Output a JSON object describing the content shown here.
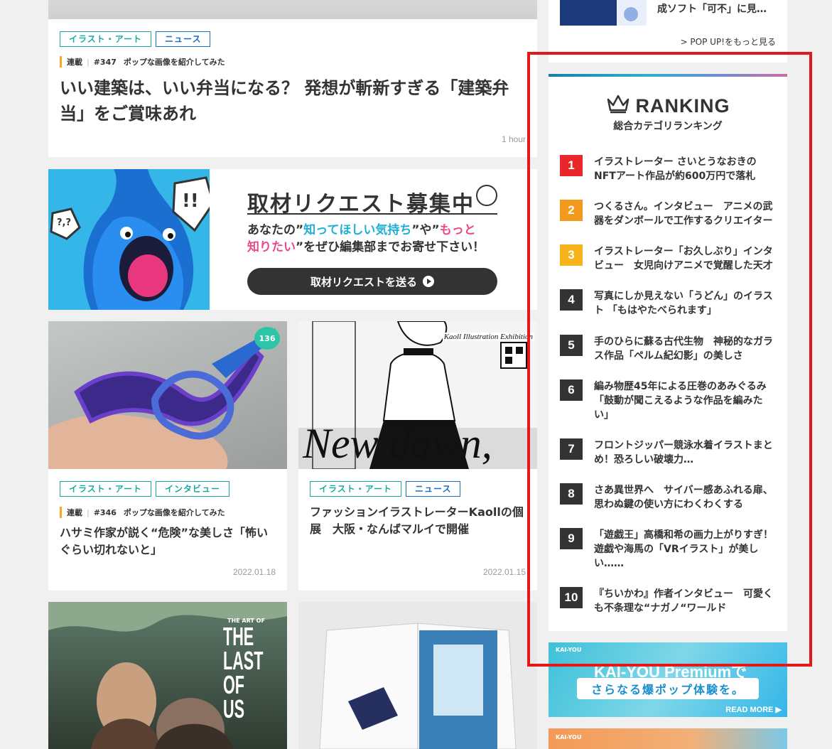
{
  "top_article": {
    "tags": [
      "イラスト・アート",
      "ニュース"
    ],
    "serial_label": "連載",
    "serial_number": "#347",
    "serial_name": "ポップな画像を紹介してみた",
    "title": "いい建築は、いい弁当になる？ 発想が斬新すぎる「建築弁当」をご賞味あれ",
    "date": "1 hour"
  },
  "request_banner": {
    "title": "取材リクエスト募集中",
    "line1_a": "あなたの”",
    "line1_b": "知ってほしい気持ち",
    "line1_c": "”や”",
    "line1_d": "もっと",
    "line2_a": "知りたい",
    "line2_b": "”をぜひ編集部までお寄せ下さい！",
    "button": "取材リクエストを送る",
    "bubble_mark": "!!",
    "small_mark": "?,?"
  },
  "articles": [
    {
      "tags": [
        "イラスト・アート",
        "インタビュー"
      ],
      "comments": "136",
      "serial_label": "連載",
      "serial_number": "#346",
      "serial_name": "ポップな画像を紹介してみた",
      "title": "ハサミ作家が説く“危険”な美しさ「怖いぐらい切れないと」",
      "date": "2022.01.18"
    },
    {
      "tags": [
        "イラスト・アート",
        "ニュース"
      ],
      "image_caption": "New dawn,",
      "image_label": "Kaoll Illustration Exhibition",
      "title": "ファッションイラストレーターKaollの個展　大阪・なんばマルイで開催",
      "date": "2022.01.15"
    },
    {
      "image_caption": "THE LAST OF US",
      "image_label": "THE ART OF"
    },
    {}
  ],
  "popup": {
    "title": "成ソフト「可不」に見…",
    "more_link": "> POP UP!をもっと見る"
  },
  "ranking": {
    "title": "RANKING",
    "subtitle": "総合カテゴリランキング",
    "items": [
      {
        "rank": "1",
        "color": "#e8262b",
        "text": "イラストレーター さいとうなおきのNFTアート作品が約600万円で落札"
      },
      {
        "rank": "2",
        "color": "#f39a1e",
        "text": "つくるさん。インタビュー　アニメの武器をダンボールで工作するクリエイター"
      },
      {
        "rank": "3",
        "color": "#f6b31b",
        "text": "イラストレーター「お久しぶり」インタビュー　女児向けアニメで覚醒した天才"
      },
      {
        "rank": "4",
        "color": "#333333",
        "text": "写真にしか見えない「うどん」のイラスト 「もはやたべられます」"
      },
      {
        "rank": "5",
        "color": "#333333",
        "text": "手のひらに蘇る古代生物　神秘的なガラス作品「ペルム紀幻影」の美しさ"
      },
      {
        "rank": "6",
        "color": "#333333",
        "text": "編み物歴45年による圧巻のあみぐるみ　「鼓動が聞こえるような作品を編みたい」"
      },
      {
        "rank": "7",
        "color": "#333333",
        "text": "フロントジッパー競泳水着イラストまとめ！恐ろしい破壊力…"
      },
      {
        "rank": "8",
        "color": "#333333",
        "text": "さあ異世界へ　サイバー感あふれる扉、思わぬ鍵の使い方にわくわくする"
      },
      {
        "rank": "9",
        "color": "#333333",
        "text": "「遊戯王」高橋和希の画力上がりすぎ！遊戯や海馬の「VRイラスト」が美しい……"
      },
      {
        "rank": "10",
        "color": "#333333",
        "text": "『ちいかわ』作者インタビュー　可愛くも不条理な“ナガノ“ワールド"
      }
    ]
  },
  "premium_ad": {
    "logo": "KAI-YOU",
    "title": "KAI-YOU Premiumで",
    "tagline": "さらなる爆ポップ体験を。",
    "button": "READ MORE ▶"
  },
  "kai_ad": {
    "logo": "KAI-YOU"
  }
}
